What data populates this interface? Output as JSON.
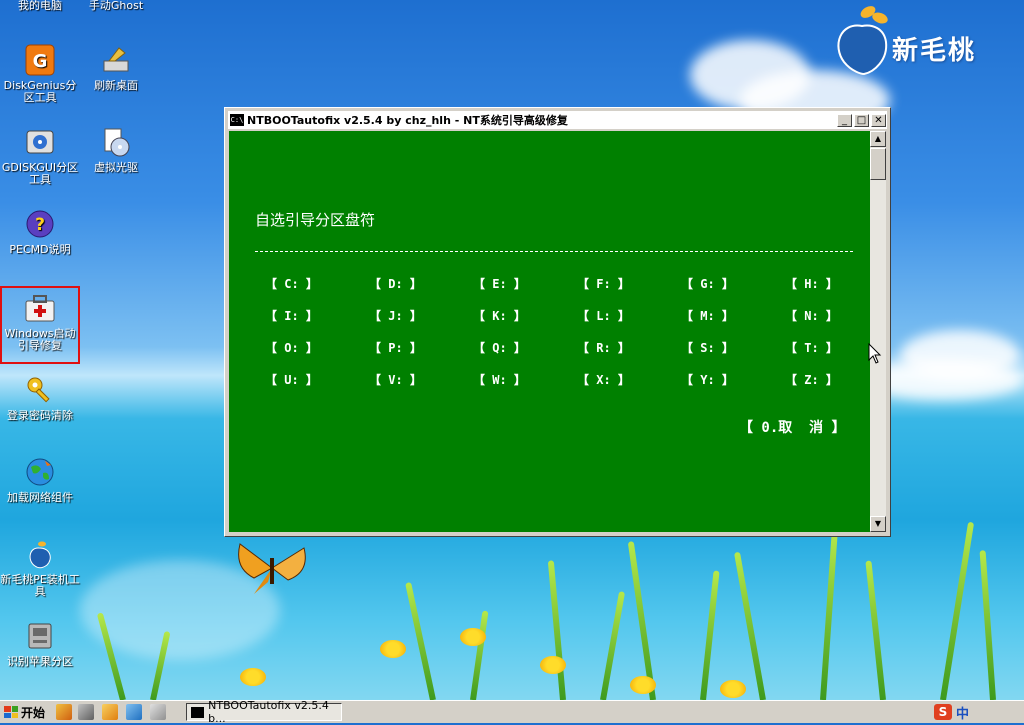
{
  "desktop": {
    "top_labels": [
      "我的电脑",
      "手动Ghost"
    ],
    "icons": [
      {
        "label": "DiskGenius分区工具",
        "icon": "diskgenius-icon"
      },
      {
        "label": "刷新桌面",
        "icon": "refresh-desktop-icon"
      },
      {
        "label": "GDISKGUI分区工具",
        "icon": "gdisk-gui-icon"
      },
      {
        "label": "虚拟光驱",
        "icon": "virtual-cd-icon"
      },
      {
        "label": "PECMD说明",
        "icon": "help-icon"
      },
      {
        "label": "Windows启动引导修复",
        "icon": "boot-repair-icon"
      },
      {
        "label": "登录密码清除",
        "icon": "key-icon"
      },
      {
        "label": "加载网络组件",
        "icon": "network-globe-icon"
      },
      {
        "label": "新毛桃PE装机工具",
        "icon": "pe-installer-icon"
      },
      {
        "label": "识别苹果分区",
        "icon": "apple-partition-icon"
      }
    ],
    "logo_text": "新毛桃"
  },
  "window": {
    "title": "NTBOOTautofix v2.5.4 by chz_hlh - NT系统引导高级修复",
    "title_icon": "C:\\",
    "buttons": {
      "minimize": "_",
      "maximize": "□",
      "close": "✕"
    },
    "console": {
      "prompt": "自选引导分区盘符",
      "drives": [
        "【 C: 】",
        "【 D: 】",
        "【 E: 】",
        "【 F: 】",
        "【 G: 】",
        "【 H: 】",
        "【 I: 】",
        "【 J: 】",
        "【 K: 】",
        "【 L: 】",
        "【 M: 】",
        "【 N: 】",
        "【 O: 】",
        "【 P: 】",
        "【 Q: 】",
        "【 R: 】",
        "【 S: 】",
        "【 T: 】",
        "【 U: 】",
        "【 V: 】",
        "【 W: 】",
        "【 X: 】",
        "【 Y: 】",
        "【 Z: 】"
      ],
      "cancel": "【 0.取  消 】"
    },
    "colors": {
      "console_bg": "#008000",
      "console_fg": "#ffffff"
    }
  },
  "taskbar": {
    "start_label": "开始",
    "task_label": "NTBOOTautofix v2.5.4 b...",
    "tray_label": "中"
  }
}
